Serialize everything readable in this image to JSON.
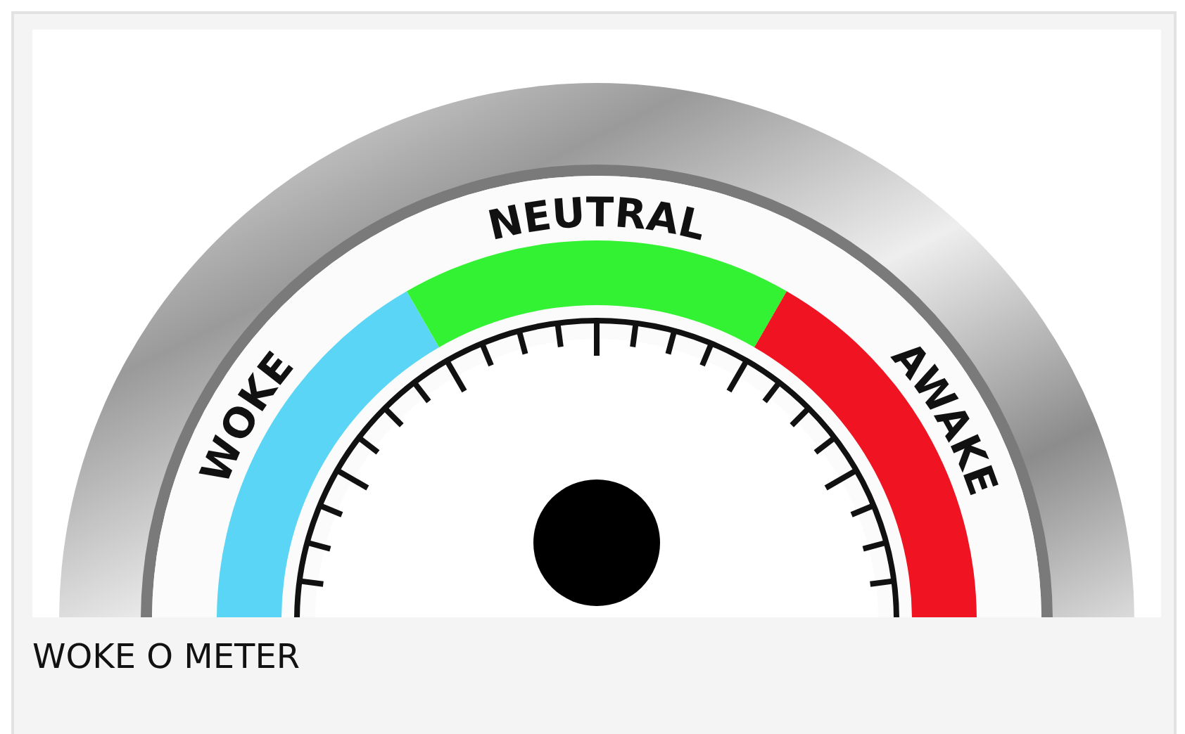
{
  "gauge": {
    "zones": [
      {
        "label": "WOKE",
        "color": "#5bd5f5"
      },
      {
        "label": "NEUTRAL",
        "color": "#33f233"
      },
      {
        "label": "AWAKE",
        "color": "#f01423"
      }
    ]
  },
  "caption": "WOKE O METER"
}
